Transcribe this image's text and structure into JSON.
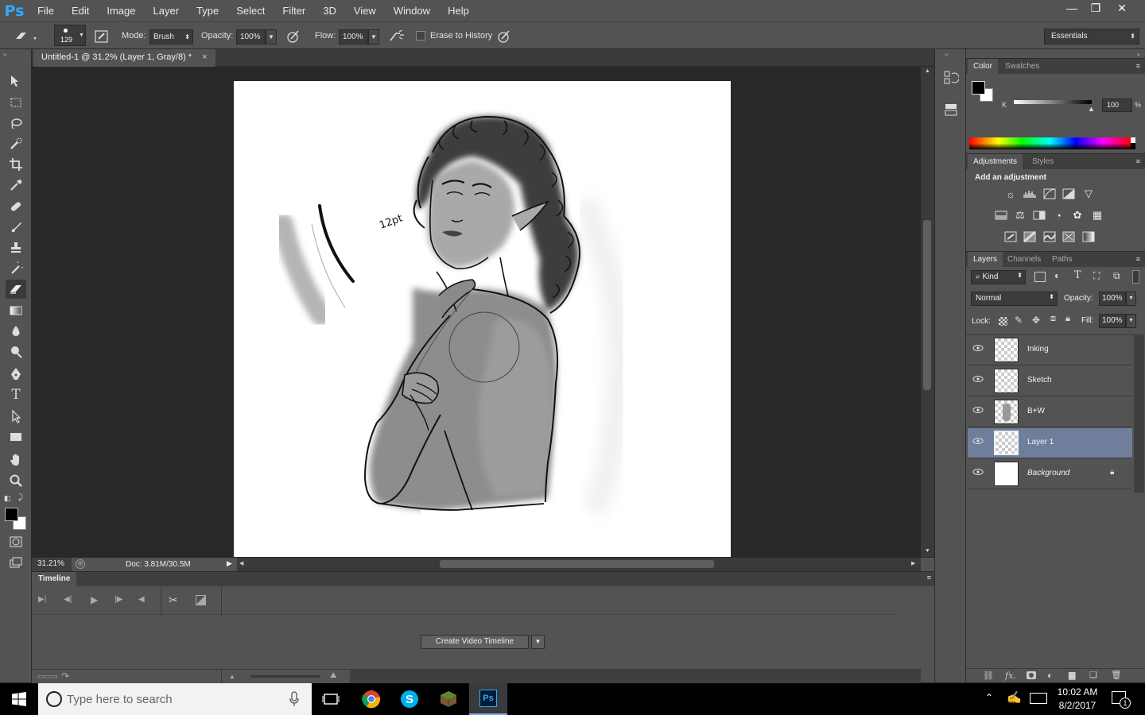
{
  "app": {
    "logo": "Ps"
  },
  "menu": [
    "File",
    "Edit",
    "Image",
    "Layer",
    "Type",
    "Select",
    "Filter",
    "3D",
    "View",
    "Window",
    "Help"
  ],
  "window_controls": {
    "minimize": "—",
    "restore": "❐",
    "close": "✕"
  },
  "options": {
    "brush_size": "129",
    "mode_label": "Mode:",
    "mode_value": "Brush",
    "opacity_label": "Opacity:",
    "opacity_value": "100%",
    "flow_label": "Flow:",
    "flow_value": "100%",
    "erase_history_label": "Erase to History",
    "erase_history_checked": false,
    "workspace": "Essentials"
  },
  "document": {
    "tab_title": "Untitled-1 @ 31.2% (Layer 1, Gray/8) *",
    "close_glyph": "×",
    "annotation": "12pt"
  },
  "status": {
    "zoom": "31.21%",
    "doc": "Doc: 3.81M/30.5M"
  },
  "timeline": {
    "title": "Timeline",
    "create_button": "Create Video Timeline"
  },
  "color_panel": {
    "tabs": [
      "Color",
      "Swatches"
    ],
    "channel_label": "K",
    "value": "100",
    "unit": "%",
    "k_level": 1.0,
    "foreground": "#000000",
    "background": "#ffffff"
  },
  "adjustments_panel": {
    "tabs": [
      "Adjustments",
      "Styles"
    ],
    "heading": "Add an adjustment"
  },
  "layers_panel": {
    "tabs": [
      "Layers",
      "Channels",
      "Paths"
    ],
    "filter_kind": "Kind",
    "blend_mode": "Normal",
    "opacity_label": "Opacity:",
    "opacity_value": "100%",
    "lock_label": "Lock:",
    "fill_label": "Fill:",
    "fill_value": "100%",
    "layers": [
      {
        "name": "Inking",
        "selected": false
      },
      {
        "name": "Sketch",
        "selected": false
      },
      {
        "name": "B+W",
        "selected": false
      },
      {
        "name": "Layer 1",
        "selected": true
      },
      {
        "name": "Background",
        "selected": false
      }
    ],
    "footer_fx": "fx."
  },
  "taskbar": {
    "search_placeholder": "Type here to search",
    "time": "10:02 AM",
    "date": "8/2/2017",
    "notifications": "1",
    "ps_label": "Ps"
  },
  "colors": {
    "accent": "#31a8ff",
    "selected_layer": "#6f7e9a",
    "panel": "#535353",
    "dark": "#282828"
  }
}
